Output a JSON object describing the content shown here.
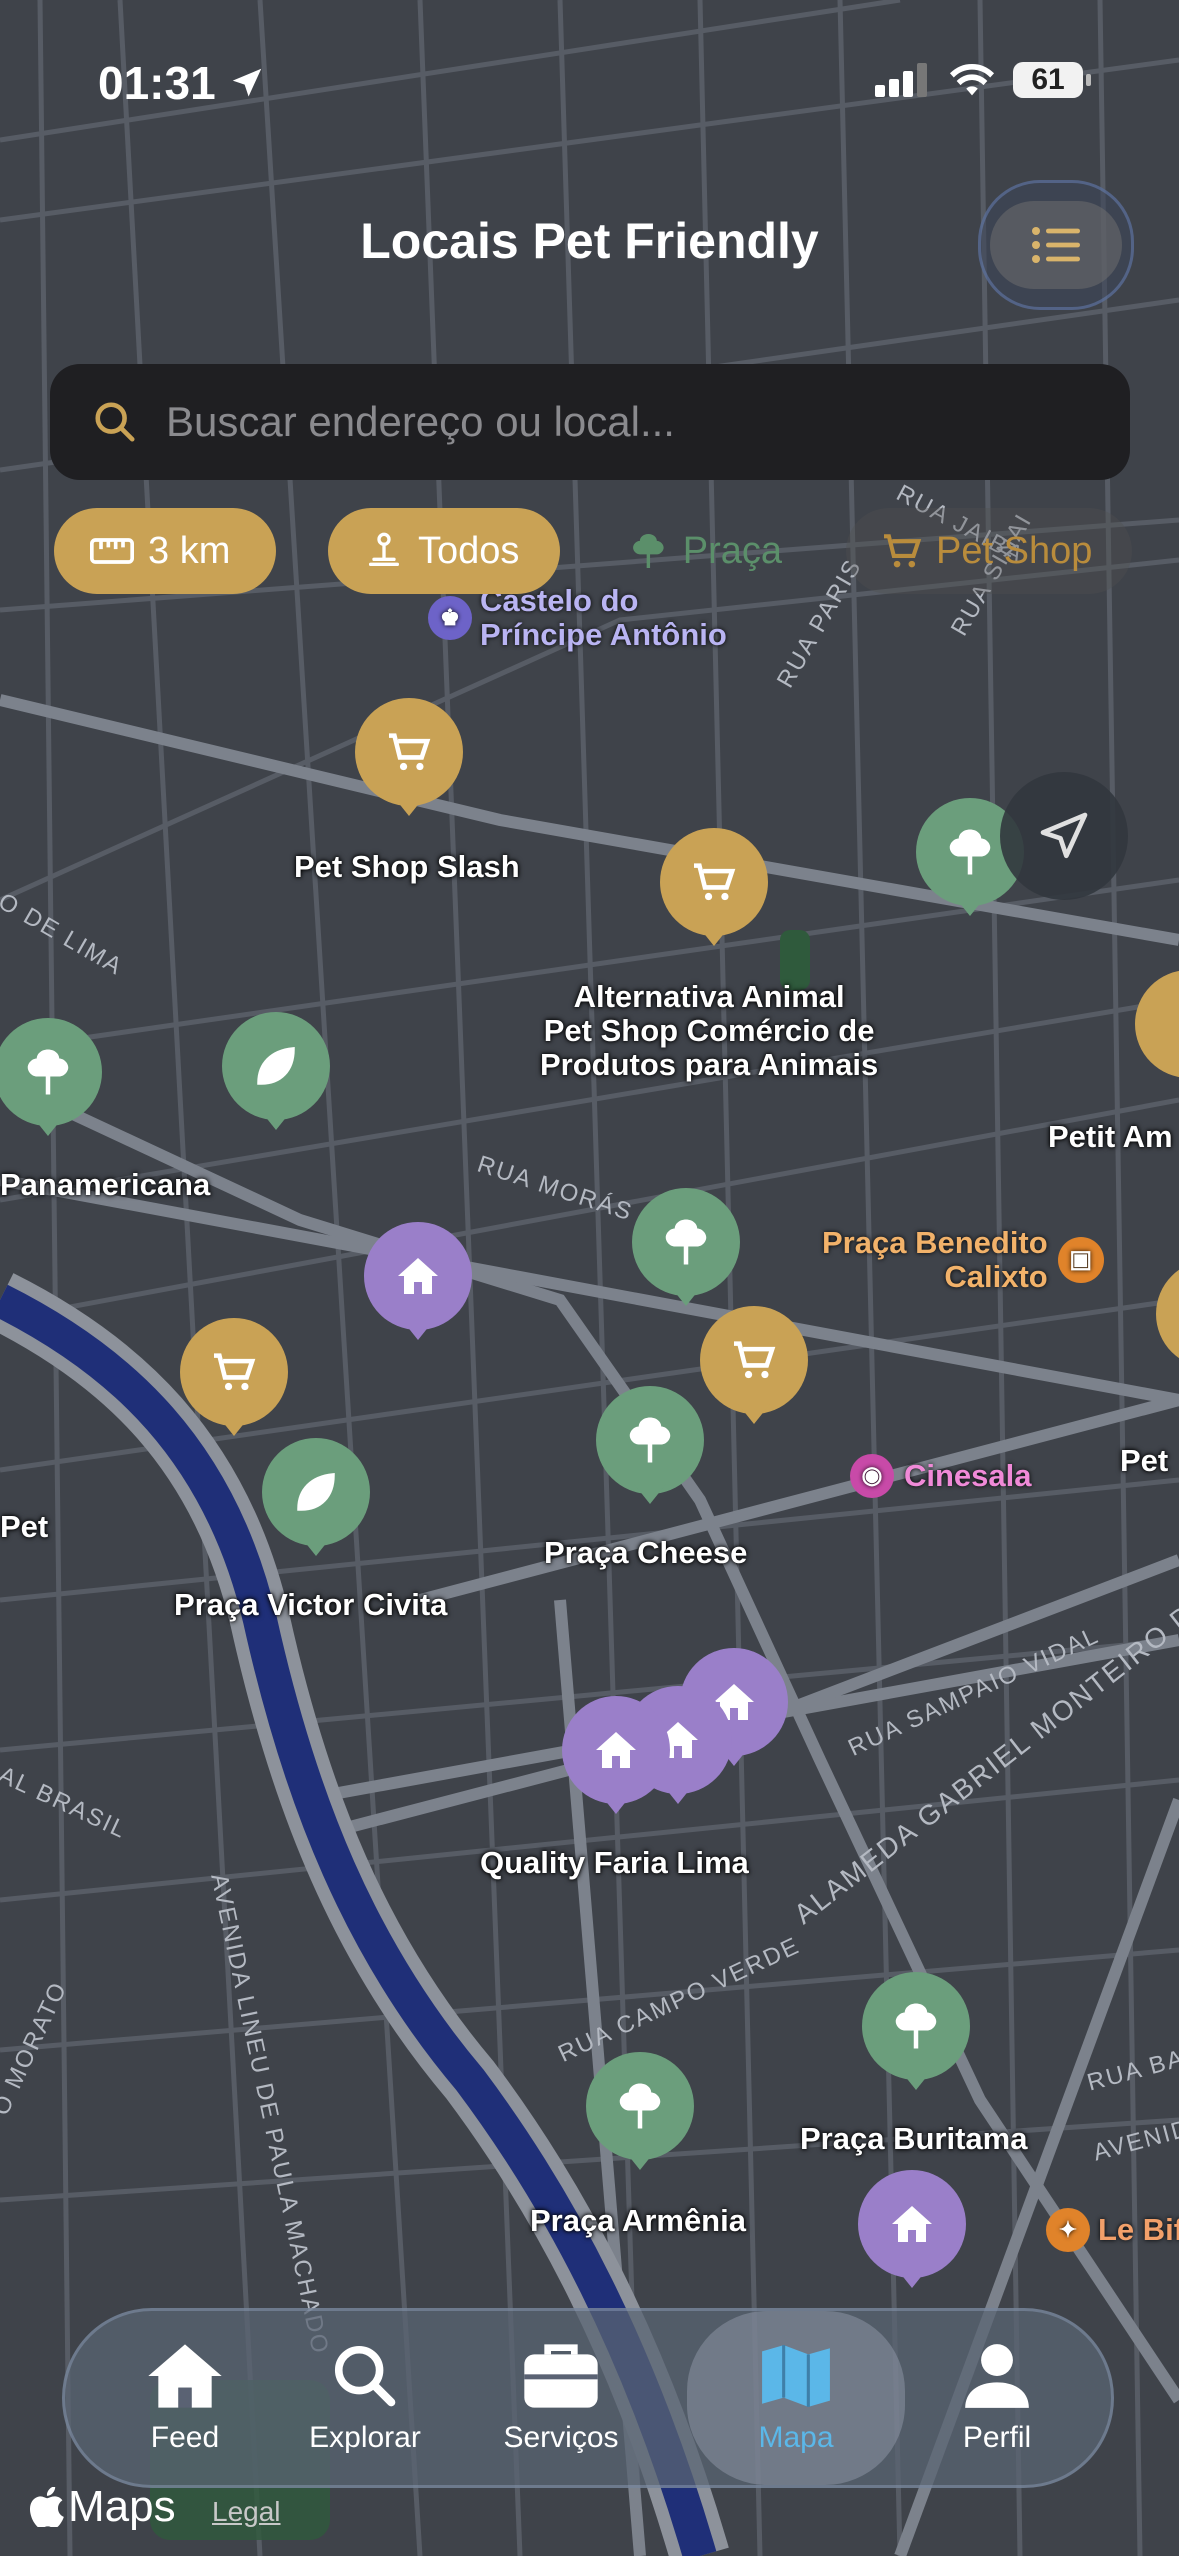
{
  "status": {
    "time": "01:31",
    "battery": "61"
  },
  "header": {
    "title": "Locais Pet Friendly"
  },
  "search": {
    "placeholder": "Buscar endereço ou local..."
  },
  "filters": [
    {
      "label": "3 km",
      "icon": "ruler-icon"
    },
    {
      "label": "Todos",
      "icon": "joystick-icon"
    },
    {
      "label": "Praça",
      "icon": "tree-icon"
    },
    {
      "label": "Pet Shop",
      "icon": "cart-icon"
    }
  ],
  "places": {
    "pet_shop_slash": "Pet Shop Slash",
    "alternativa_animal": "Alternativa Animal\nPet Shop Comércio de\nProdutos para Animais",
    "petit_am": "Petit Am",
    "panamericana": "Panamericana",
    "praca_cheese": "Praça Cheese",
    "praca_victor_civita": "Praça Victor Civita",
    "pet_left": "Pet",
    "pet_right": "Pet",
    "quality_faria_lima": "Quality Faria Lima",
    "praca_buritama": "Praça Buritama",
    "praca_armenia": "Praça Armênia"
  },
  "map_pois": {
    "castelo": "Castelo do\nPríncipe Antônio",
    "praca_benedito": "Praça Benedito\nCalixto",
    "cinesala": "Cinesala",
    "le_bife": "Le Bife"
  },
  "streets": {
    "rua_moras": "RUA MORÁS",
    "rua_paris": "RUA PARIS",
    "rua_sinai": "RUA SINAI",
    "rua_jaiba": "RUA JAIBA",
    "rua_sampaio_vidal": "RUA SAMPAIO VIDAL",
    "alameda_gabriel": "ALAMEDA GABRIEL MONTEIRO DA SILVA",
    "rua_campo_verde": "RUA CAMPO VERDE",
    "avenida_lineu": "AVENIDA LINEU DE PAULA MACHADO",
    "al_brasil": "AL BRASIL",
    "o_morato": "O MORATO",
    "o_de_lima": "O DE LIMA",
    "avenida": "AVENIDA",
    "rua_balsa": "RUA BA"
  },
  "tabs": [
    {
      "label": "Feed",
      "icon": "house-icon"
    },
    {
      "label": "Explorar",
      "icon": "magnifier-icon"
    },
    {
      "label": "Serviços",
      "icon": "briefcase-icon"
    },
    {
      "label": "Mapa",
      "icon": "map-icon",
      "active": true
    },
    {
      "label": "Perfil",
      "icon": "person-icon"
    }
  ],
  "footer": {
    "brand": "Maps",
    "legal": "Legal"
  },
  "colors": {
    "gold": "#c9a255",
    "green": "#6b9e7c",
    "purple": "#9a7fc9",
    "active_tab": "#5bb7e8",
    "river": "#1f2f78"
  }
}
